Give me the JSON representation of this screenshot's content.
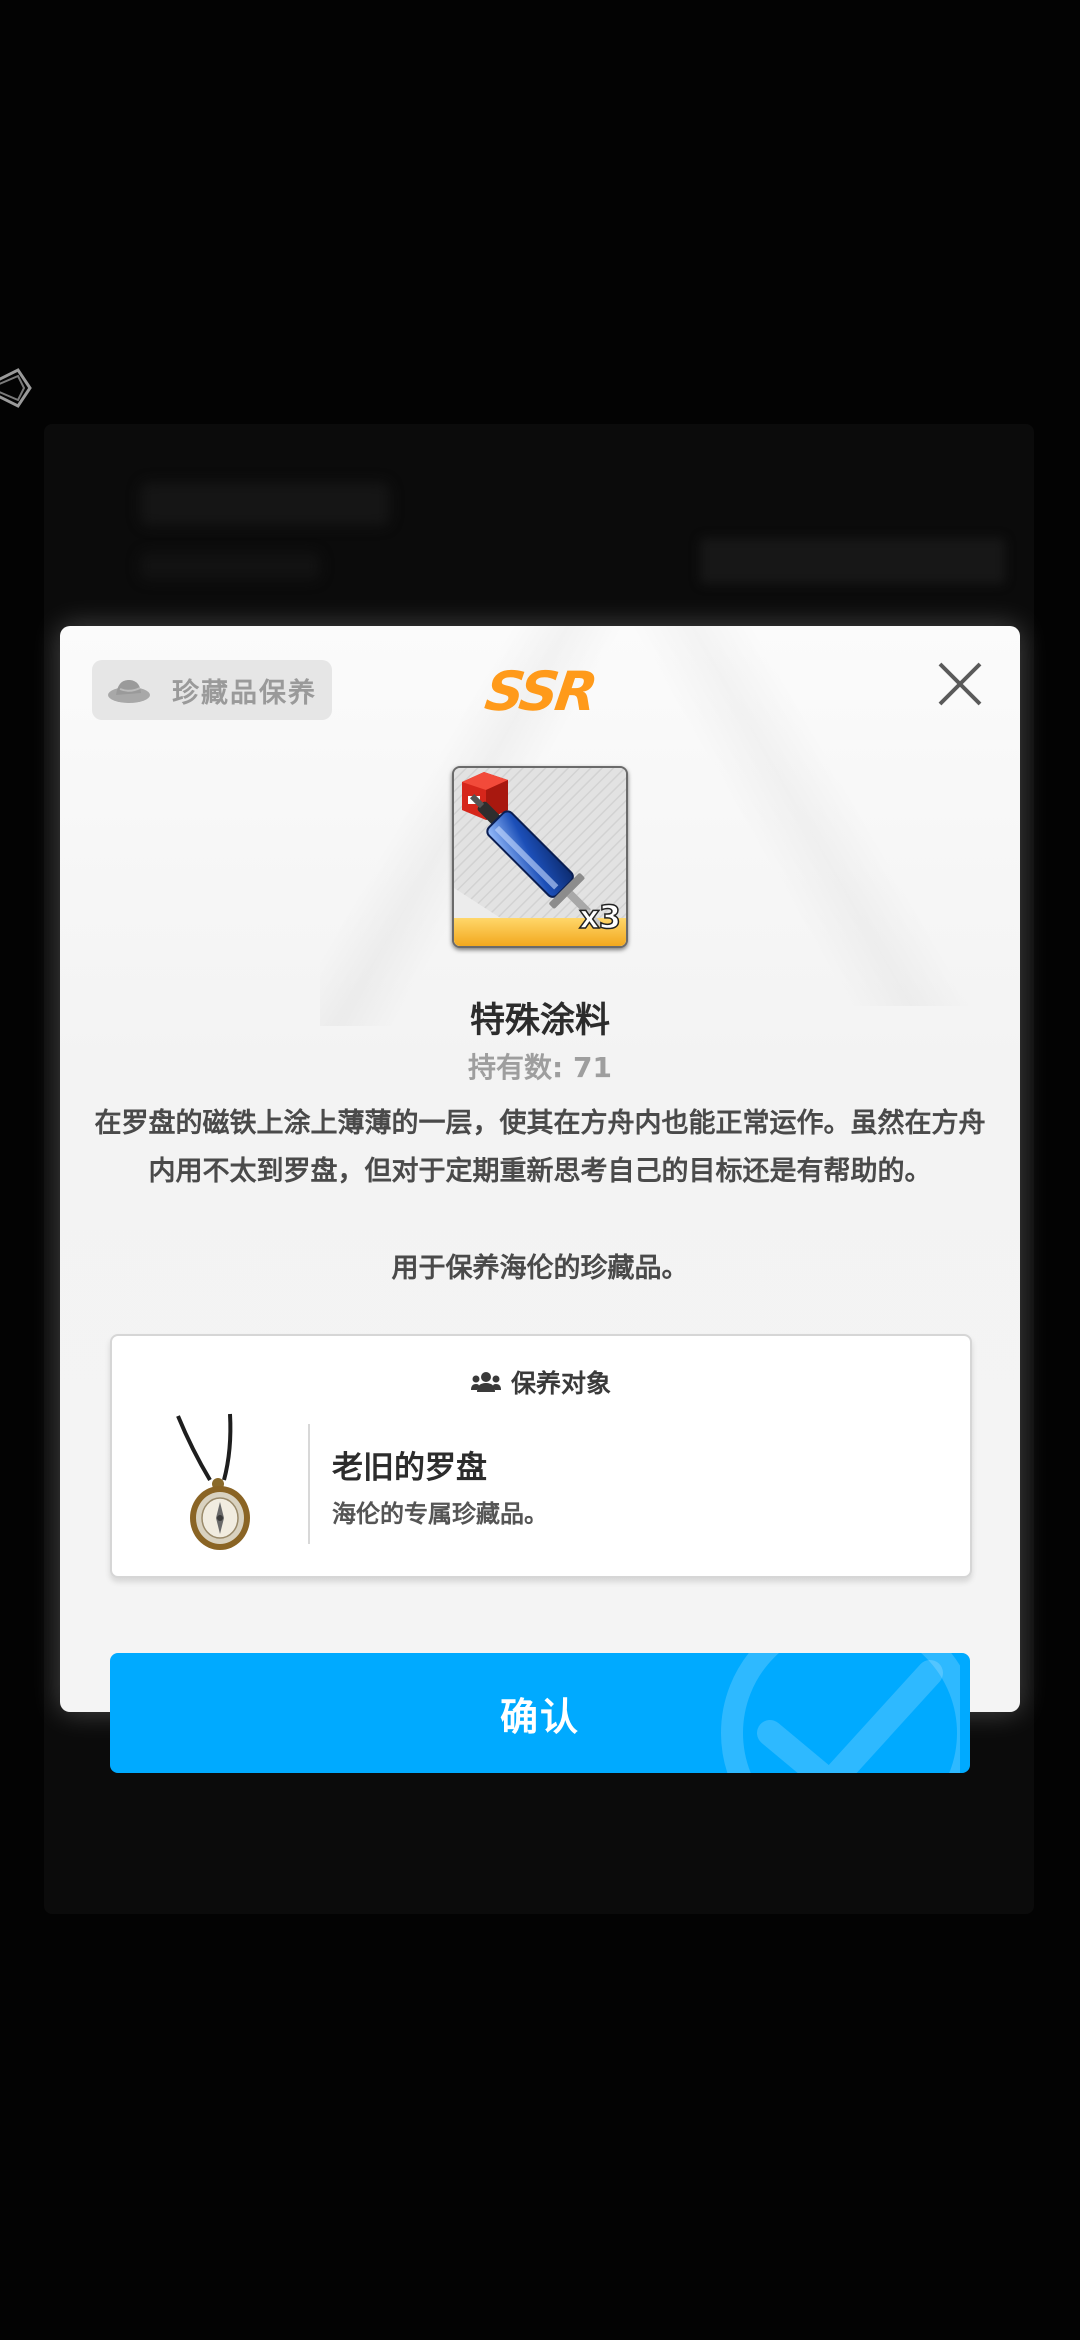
{
  "modal": {
    "tag_label": "珍藏品保养",
    "rarity": "SSR",
    "item": {
      "name": "特殊涂料",
      "quantity_badge": "x3",
      "owned": "持有数: 71",
      "description": "在罗盘的磁铁上涂上薄薄的一层，使其在方舟内也能正常运作。虽然在方舟内用不太到罗盘，但对于定期重新思考自己的目标还是有帮助的。",
      "usage": "用于保养海伦的珍藏品。"
    },
    "target": {
      "header": "保养对象",
      "name": "老旧的罗盘",
      "description": "海伦的专属珍藏品。"
    },
    "confirm_label": "确认"
  },
  "colors": {
    "accent": "#00aaff",
    "rarity": "#ff9a1a"
  },
  "icons": {
    "tag": "hat-icon",
    "close": "close-icon",
    "target_header": "people-icon",
    "confirm_watermark": "checkmark-icon"
  }
}
